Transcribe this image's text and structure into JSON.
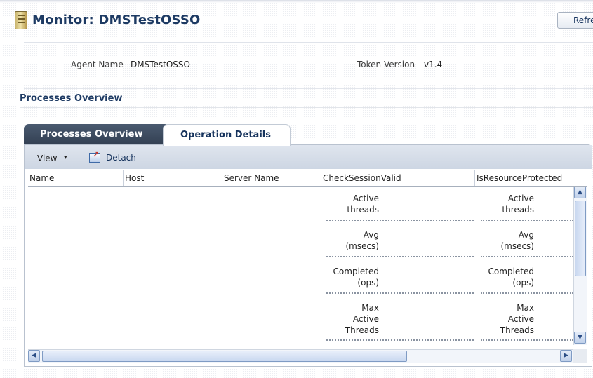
{
  "header": {
    "title": "Monitor: DMSTestOSSO",
    "refresh_label": "Refresh"
  },
  "info": {
    "agent_name_label": "Agent Name",
    "agent_name_value": "DMSTestOSSO",
    "token_version_label": "Token Version",
    "token_version_value": "v1.4"
  },
  "section": {
    "title": "Processes Overview"
  },
  "tabs": [
    {
      "label": "Processes Overview",
      "selected": false
    },
    {
      "label": "Operation Details",
      "selected": true
    }
  ],
  "toolbar": {
    "view_label": "View",
    "view_caret": "▾",
    "detach_label": "Detach"
  },
  "table": {
    "columns": [
      "Name",
      "Host",
      "Server Name",
      "CheckSessionValid",
      "IsResourceProtected"
    ],
    "metrics": [
      [
        "Active",
        "threads"
      ],
      [
        "Avg",
        "(msecs)"
      ],
      [
        "Completed",
        "(ops)"
      ],
      [
        "Max",
        "Active",
        "Threads"
      ]
    ]
  },
  "scrollbar": {
    "up_arrow": "▲",
    "down_arrow": "▼",
    "left_arrow": "◀",
    "right_arrow": "▶"
  }
}
